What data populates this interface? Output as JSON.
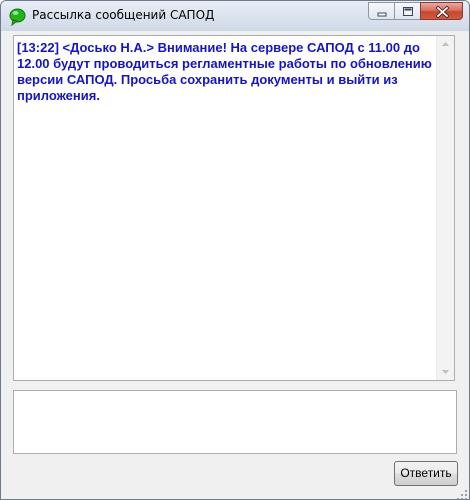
{
  "window": {
    "title": "Рассылка сообщений САПОД"
  },
  "log": {
    "message": "[13:22] <Досько Н.А.> Внимание! На сервере САПОД с 11.00 до 12.00 будут проводиться регламентные работы по обновлению версии САПОД. Просьба сохранить документы и выйти из приложения."
  },
  "reply_input": {
    "value": ""
  },
  "actions": {
    "reply_label": "Ответить"
  },
  "colors": {
    "message_text": "#1515c8",
    "app_icon": "#23b81a"
  },
  "icons": {
    "app": "green-speech-bubble-icon",
    "minimize": "minimize-icon",
    "maximize": "maximize-icon",
    "close": "close-icon"
  }
}
